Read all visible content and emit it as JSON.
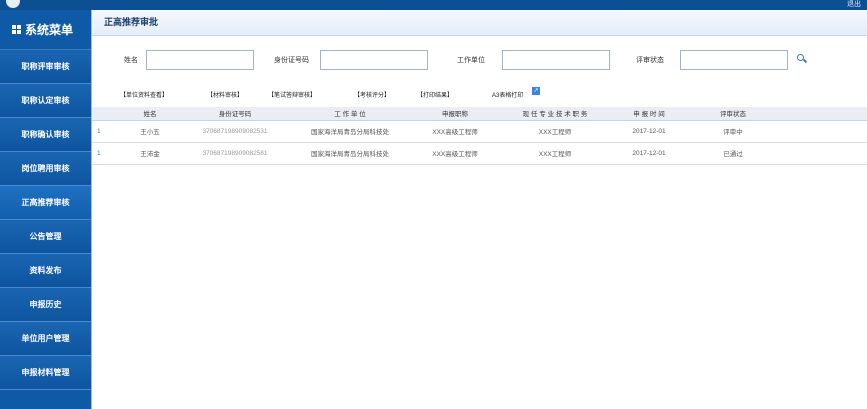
{
  "topbar": {
    "exit_label": "退出"
  },
  "sidebar": {
    "title": "系统菜单",
    "items": [
      {
        "label": "职称评审审核"
      },
      {
        "label": "职称认定审核"
      },
      {
        "label": "职称确认审核"
      },
      {
        "label": "岗位聘用审核"
      },
      {
        "label": "正高推荐审核"
      },
      {
        "label": "公告管理"
      },
      {
        "label": "资料发布"
      },
      {
        "label": "申报历史"
      },
      {
        "label": "单位用户管理"
      },
      {
        "label": "申报材料管理"
      }
    ]
  },
  "main": {
    "title": "正高推荐审批",
    "search": {
      "name_label": "姓名",
      "name_value": "",
      "id_label": "身份证号码",
      "id_value": "",
      "unit_label": "工作单位",
      "unit_value": "",
      "status_label": "评审状态",
      "status_value": ""
    },
    "toolbar": [
      {
        "label": "【单位资料查看】"
      },
      {
        "label": "【材料审核】"
      },
      {
        "label": "【笔试答辩审核】"
      },
      {
        "label": "【考核评分】"
      },
      {
        "label": "【打印结果】"
      },
      {
        "label": "A3表格打印"
      }
    ],
    "toolbar_badge": "↗",
    "table": {
      "columns": [
        "",
        "姓名",
        "身份证号码",
        "工 作 单 位",
        "申报职称",
        "现 任 专 业 技 术 职 务",
        "申 报 时 间",
        "评审状态"
      ],
      "rows": [
        {
          "num": "1",
          "name": "王小五",
          "id": "370687198909082531",
          "unit": "国家海洋局青岛分局科技处",
          "title": "XXX高级工程师",
          "current": "XXX工程师",
          "date": "2017-12-01",
          "status": "评审中"
        },
        {
          "num": "1",
          "name": "王沛金",
          "id": "370687198909082581",
          "unit": "国家海洋局青岛分局科技处",
          "title": "XXX高级工程师",
          "current": "XXX工程师",
          "date": "2017-12-01",
          "status": "已通过"
        }
      ]
    }
  }
}
